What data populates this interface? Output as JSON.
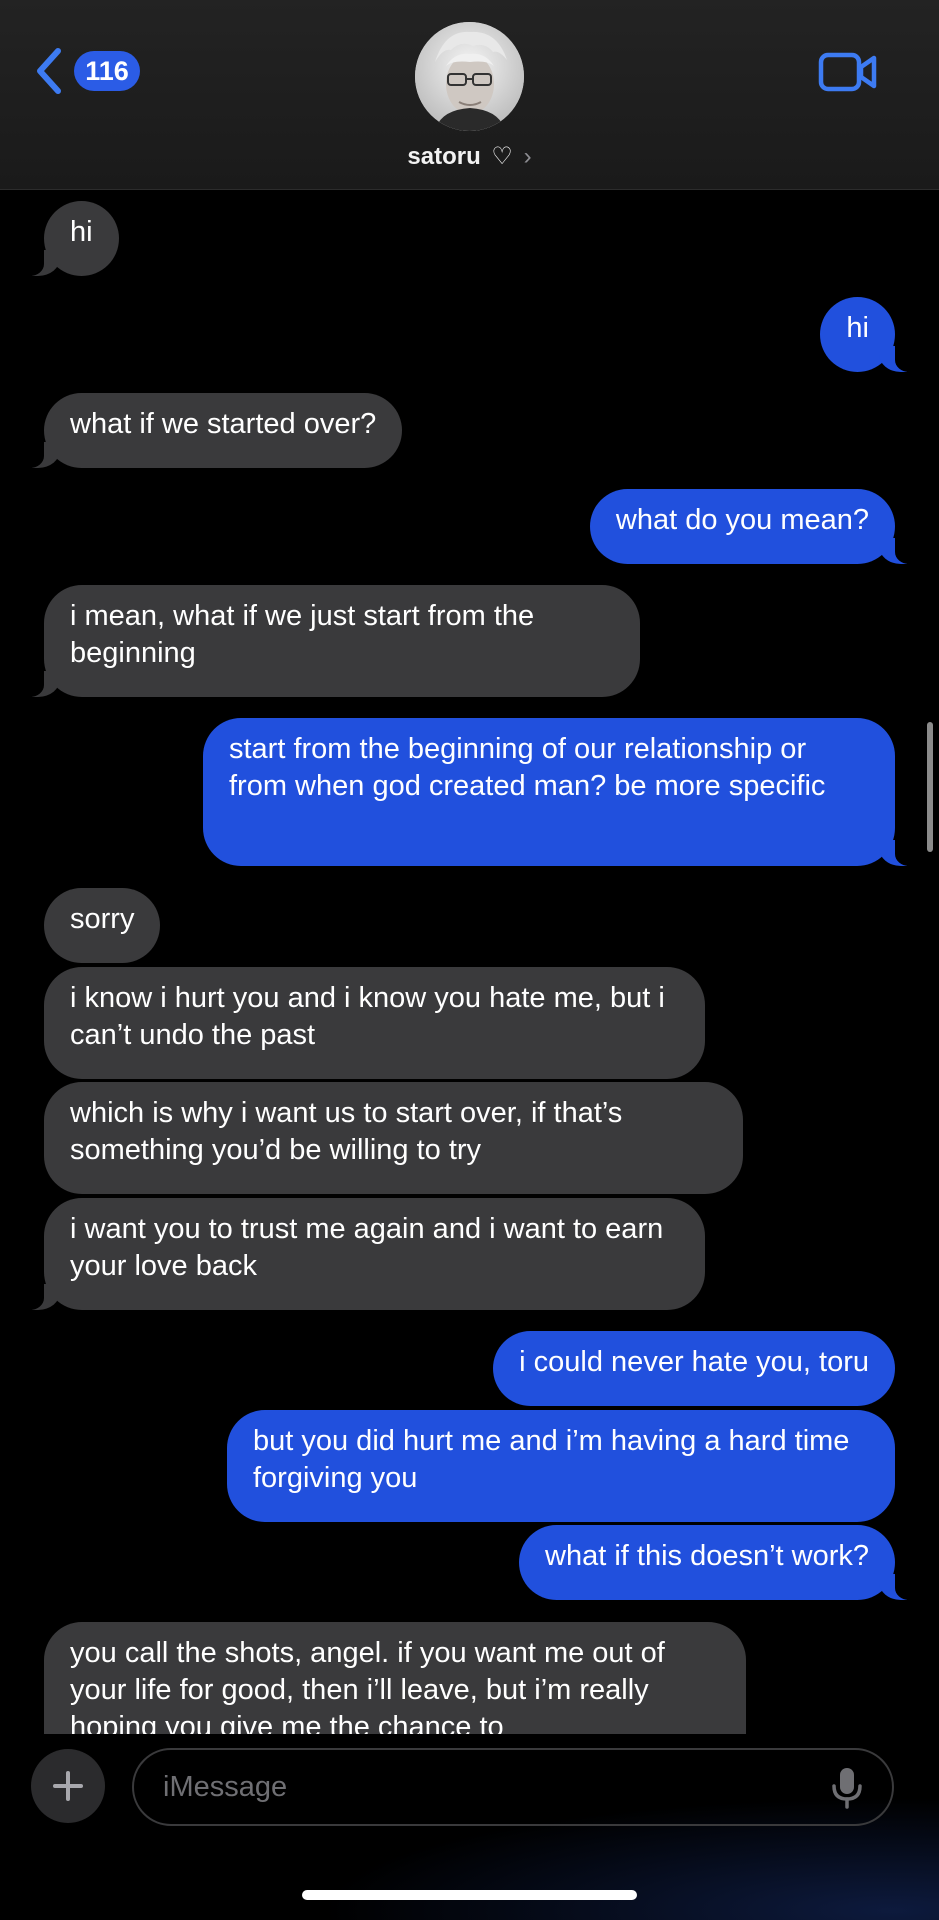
{
  "header": {
    "back_count": "116",
    "contact_name": "satoru",
    "heart": "♡",
    "chevron": "›",
    "back_icon": "chevron-left-icon",
    "video_icon": "video-camera-icon"
  },
  "messages": [
    {
      "from": "them",
      "text": "hi"
    },
    {
      "from": "me",
      "text": "hi"
    },
    {
      "from": "them",
      "text": "what if we started over?"
    },
    {
      "from": "me",
      "text": "what do you mean?"
    },
    {
      "from": "them",
      "text": "i mean, what if we just start from the beginning"
    },
    {
      "from": "me",
      "text": "start from the beginning of our relationship or from when god created man? be more specific"
    },
    {
      "from": "them",
      "text": "sorry"
    },
    {
      "from": "them",
      "text": "i know i hurt you and i know you hate me, but i can’t undo the past"
    },
    {
      "from": "them",
      "text": "which is why i want us to start over, if that’s something you’d be willing to try"
    },
    {
      "from": "them",
      "text": "i want you to trust me again and i want to earn your love back"
    },
    {
      "from": "me",
      "text": "i could never hate you, toru"
    },
    {
      "from": "me",
      "text": "but you did hurt me and i’m having a hard time forgiving you"
    },
    {
      "from": "me",
      "text": "what if this doesn’t work?"
    },
    {
      "from": "them",
      "text": "you call the shots, angel. if you want me out of your life for good, then i’ll leave, but i’m really hoping you give me the chance to"
    }
  ],
  "composer": {
    "placeholder": "iMessage",
    "plus_icon": "plus-icon",
    "mic_icon": "microphone-icon"
  },
  "colors": {
    "sent_bubble": "#2150dd",
    "received_bubble": "#3a3a3c",
    "badge": "#2b5ce6",
    "accent": "#3d7bf2"
  }
}
